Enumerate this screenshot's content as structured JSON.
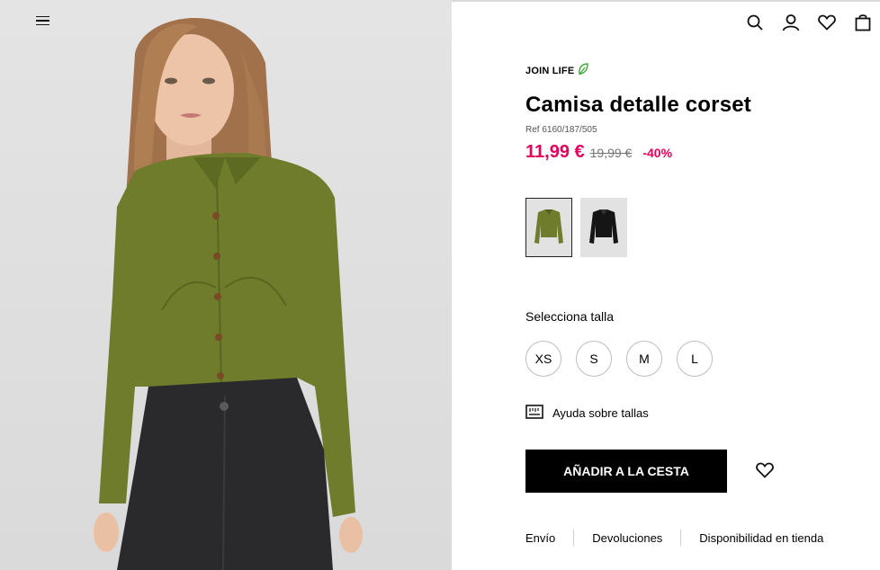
{
  "header": {
    "menu_icon": "hamburger-icon",
    "icons": [
      "search-icon",
      "user-icon",
      "heart-icon",
      "bag-icon"
    ]
  },
  "product": {
    "brand_tag": "JOIN LIFE",
    "brand_tag_icon": "leaf-icon",
    "title": "Camisa detalle corset",
    "ref": "Ref 6160/187/505",
    "price": "11,99 €",
    "old_price": "19,99 €",
    "discount": "-40%",
    "colors": {
      "accent": "#e5005b",
      "shirt": "#6e7c2c",
      "leaf": "#3aa335"
    }
  },
  "swatches": [
    {
      "color_name": "green",
      "selected": true
    },
    {
      "color_name": "black",
      "selected": false
    }
  ],
  "sizes": {
    "label": "Selecciona talla",
    "options": [
      "XS",
      "S",
      "M",
      "L"
    ]
  },
  "size_help": {
    "label": "Ayuda sobre tallas",
    "icon": "ruler-icon"
  },
  "actions": {
    "add_to_cart": "AÑADIR A LA CESTA",
    "wishlist_icon": "heart-icon"
  },
  "links": [
    "Envío",
    "Devoluciones",
    "Disponibilidad en tienda"
  ]
}
